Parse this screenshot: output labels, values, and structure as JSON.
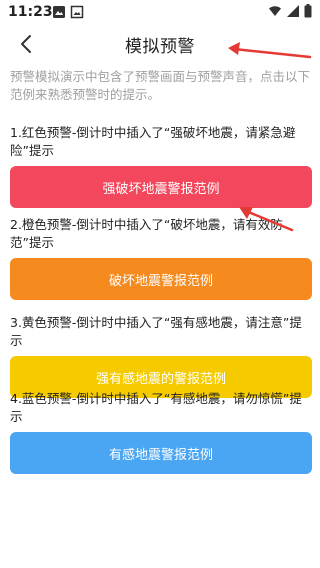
{
  "status_bar": {
    "time": "11:23",
    "left_icons": [
      "gallery-icon",
      "image-icon"
    ],
    "right_icons": [
      "wifi-icon",
      "signal-icon",
      "battery-icon"
    ]
  },
  "nav": {
    "title": "模拟预警",
    "back_icon": "chevron-left-icon"
  },
  "intro": "预警模拟演示中包含了预警画面与预警声音，点击以下范例来熟悉预警时的提示。",
  "sections": [
    {
      "text": "1.红色预警-倒计时中插入了“强破坏地震，请紧急避险”提示",
      "button": "强破坏地震警报范例",
      "color": "#f2475c"
    },
    {
      "text": "2.橙色预警-倒计时中插入了“破坏地震，请有效防范”提示",
      "button": "破坏地震警报范例",
      "color": "#f58a1f"
    },
    {
      "text": "3.黄色预警-倒计时中插入了“强有感地震，请注意”提示",
      "button": "强有感地震的警报范例",
      "color": "#f5cb00"
    },
    {
      "text": "4.蓝色预警-倒计时中插入了“有感地震，请勿惊慌”提示",
      "button": "有感地震警报范例",
      "color": "#4aa5f3"
    }
  ],
  "annotation_color": "#e53935"
}
